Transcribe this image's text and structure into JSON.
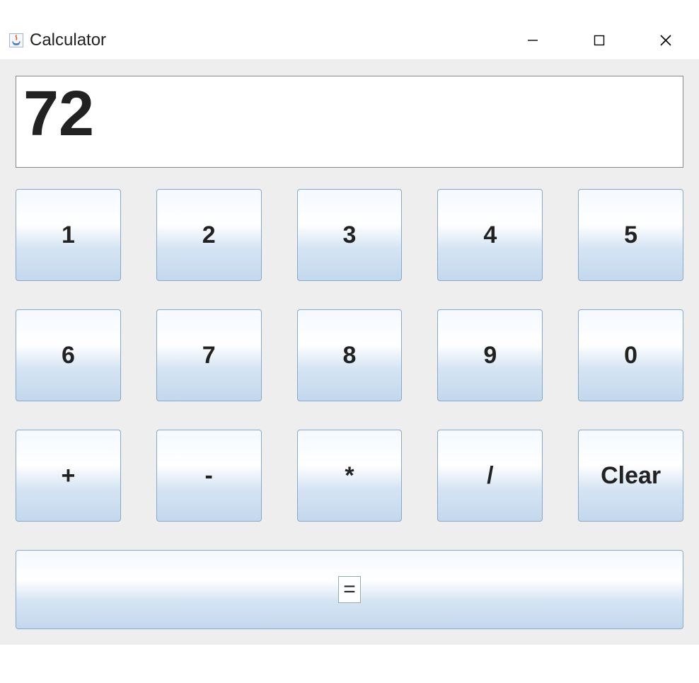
{
  "window": {
    "title": "Calculator"
  },
  "display": {
    "value": "72"
  },
  "buttons": {
    "n1": "1",
    "n2": "2",
    "n3": "3",
    "n4": "4",
    "n5": "5",
    "n6": "6",
    "n7": "7",
    "n8": "8",
    "n9": "9",
    "n0": "0",
    "add": "+",
    "sub": "-",
    "mul": "*",
    "div": "/",
    "clear": "Clear",
    "equals": "="
  }
}
